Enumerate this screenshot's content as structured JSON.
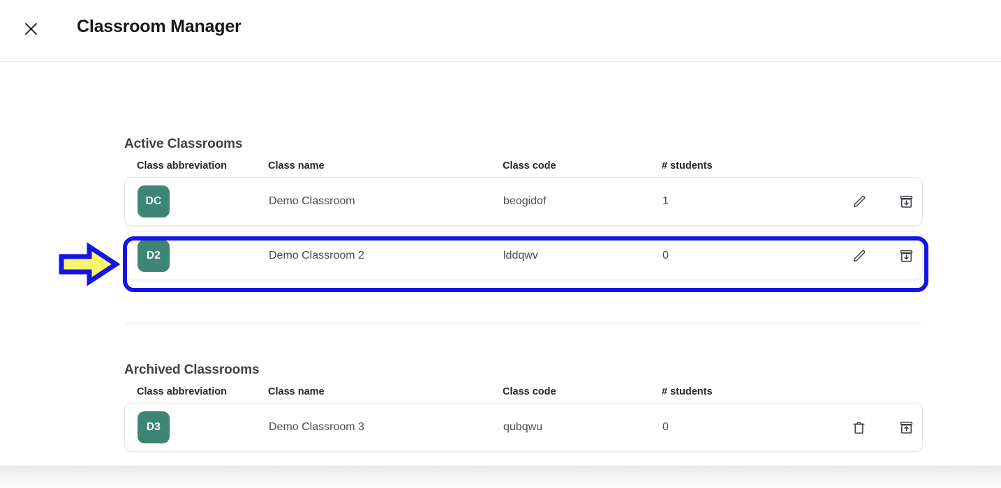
{
  "header": {
    "title": "Classroom Manager",
    "close_icon": "close-icon"
  },
  "columns": {
    "abbreviation": "Class abbreviation",
    "name": "Class name",
    "code": "Class code",
    "students": "# students"
  },
  "sections": {
    "active": {
      "title": "Active Classrooms",
      "rows": [
        {
          "abbr": "DC",
          "name": "Demo Classroom",
          "code": "beogidof",
          "students": "1",
          "action_1": "edit-icon",
          "action_2": "archive-icon"
        },
        {
          "abbr": "D2",
          "name": "Demo Classroom 2",
          "code": "lddqwv",
          "students": "0",
          "action_1": "edit-icon",
          "action_2": "archive-icon"
        }
      ]
    },
    "archived": {
      "title": "Archived Classrooms",
      "rows": [
        {
          "abbr": "D3",
          "name": "Demo Classroom 3",
          "code": "qubqwu",
          "students": "0",
          "action_1": "delete-icon",
          "action_2": "unarchive-icon"
        }
      ]
    }
  },
  "annotation": {
    "highlight_target": "Demo Classroom 2",
    "arrow_icon": "right-arrow-annotation",
    "highlight_color": "#1414e6",
    "arrow_fill_color": "#faf56e"
  },
  "colors": {
    "badge_green": "#3f8574",
    "title_text": "#18181b",
    "body_text": "#4a4a52"
  }
}
